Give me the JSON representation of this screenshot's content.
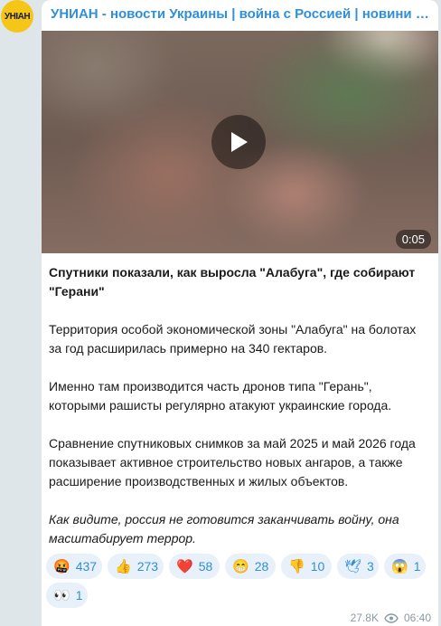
{
  "channel": {
    "avatar_text": "УНІАН",
    "name": "УНИАН - новости Украины | война с Россией | новини України..."
  },
  "video": {
    "duration": "0:05",
    "play_icon": "play-icon"
  },
  "post": {
    "title": "Спутники показали, как выросла \"Алабуга\", где собирают \"Герани\"",
    "paragraphs": [
      "Территория особой экономической зоны \"Алабуга\" на болотах за год расширилась примерно на 340 гектаров.",
      "Именно там производится часть дронов типа \"Герань\", которыми рашисты регулярно атакуют украинские города.",
      "Сравнение спутниковых снимков за май 2025 и май 2026 года показывает активное строительство новых ангаров, а также расширение производственных и жилых объектов."
    ],
    "italic": "Как видите, россия не готовится заканчивать войну, она масштабирует террор."
  },
  "reactions": [
    {
      "emoji": "🤬",
      "count": "437",
      "icon": "angry-face-icon"
    },
    {
      "emoji": "👍",
      "count": "273",
      "icon": "thumbs-up-icon"
    },
    {
      "emoji": "❤️",
      "count": "58",
      "icon": "heart-icon"
    },
    {
      "emoji": "😁",
      "count": "28",
      "icon": "grin-icon"
    },
    {
      "emoji": "👎",
      "count": "10",
      "icon": "thumbs-down-icon"
    },
    {
      "emoji": "🕊",
      "count": "3",
      "icon": "dove-icon"
    },
    {
      "emoji": "😱",
      "count": "1",
      "icon": "scream-icon"
    },
    {
      "emoji": "👀",
      "count": "1",
      "icon": "eyes-icon"
    }
  ],
  "meta": {
    "views": "27.8K",
    "time": "06:40",
    "views_icon": "eye-icon"
  }
}
